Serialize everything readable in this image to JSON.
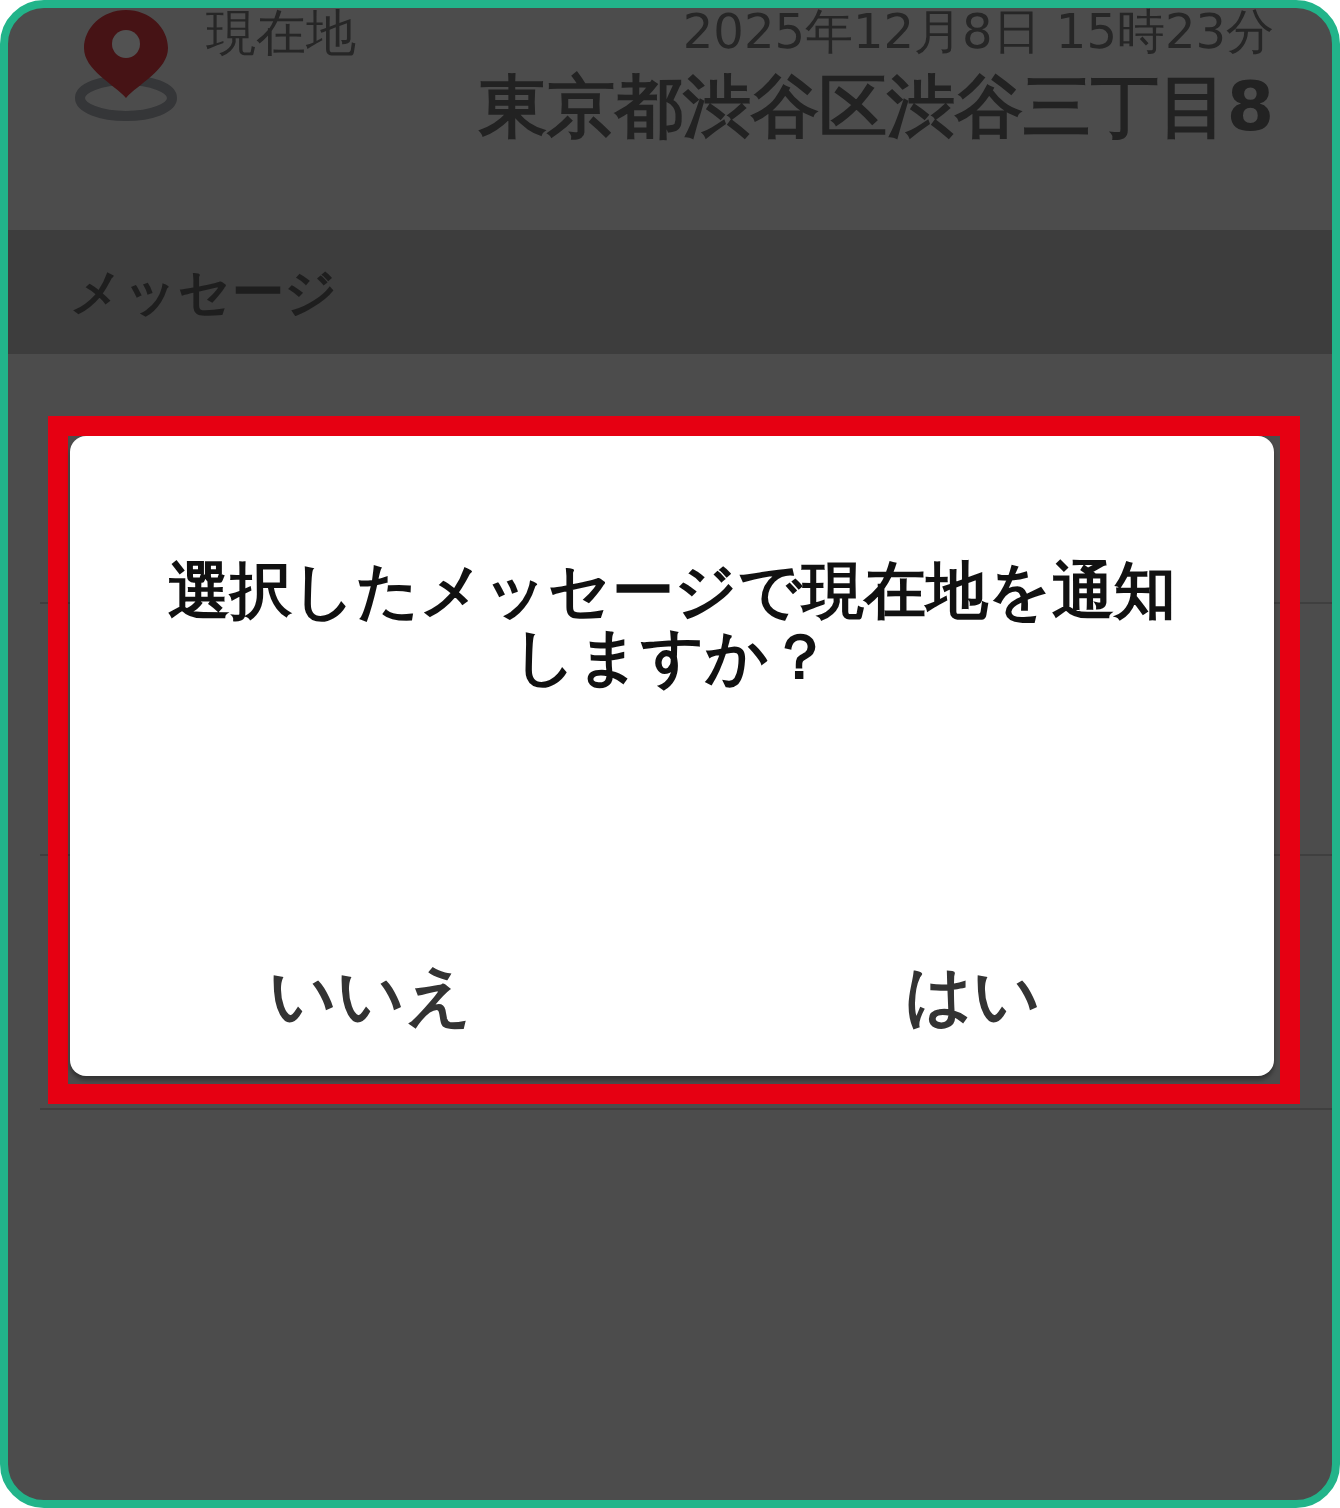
{
  "location": {
    "label": "現在地",
    "timestamp": "2025年12月8日 15時23分",
    "address": "東京都渋谷区渋谷三丁目8"
  },
  "section_header": {
    "title": "メッセージ"
  },
  "dialog": {
    "message": "選択したメッセージで現在地を通知しますか？",
    "buttons": [
      {
        "label": "いいえ"
      },
      {
        "label": "はい"
      }
    ]
  }
}
